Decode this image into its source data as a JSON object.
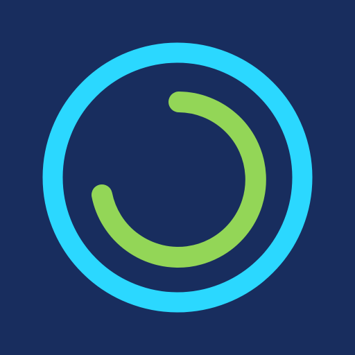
{
  "colors": {
    "background": "#182d5e",
    "outer_ring": "#2bd8ff",
    "progress_arc": "#93d657"
  },
  "icon": {
    "name": "progress-ring-logo-icon",
    "progress_fraction": 0.75
  }
}
